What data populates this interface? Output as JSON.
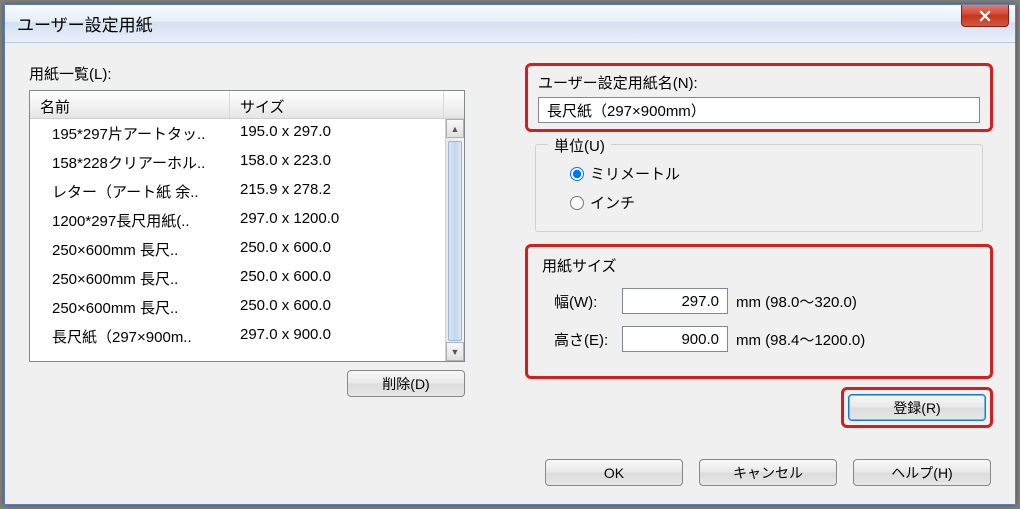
{
  "window_title": "ユーザー設定用紙",
  "list_label": "用紙一覧(L):",
  "columns": {
    "name": "名前",
    "size": "サイズ"
  },
  "col_widths": {
    "name": 200,
    "size": 214
  },
  "rows": [
    {
      "name": "195*297片アートタッ..",
      "size": "195.0 x 297.0"
    },
    {
      "name": "158*228クリアーホル..",
      "size": "158.0 x 223.0"
    },
    {
      "name": "レター（アート紙 余..",
      "size": "215.9 x 278.2"
    },
    {
      "name": "1200*297長尺用紙(..",
      "size": "297.0 x 1200.0"
    },
    {
      "name": "250×600mm 長尺..",
      "size": "250.0 x 600.0"
    },
    {
      "name": "250×600mm 長尺..",
      "size": "250.0 x 600.0"
    },
    {
      "name": "250×600mm 長尺..",
      "size": "250.0 x 600.0"
    },
    {
      "name": "長尺紙（297×900m..",
      "size": "297.0 x 900.0"
    }
  ],
  "delete_btn": "削除(D)",
  "name_label": "ユーザー設定用紙名(N):",
  "name_value": "長尺紙（297×900mm）",
  "unit_group": "単位(U)",
  "unit_mm": "ミリメートル",
  "unit_inch": "インチ",
  "unit_selected": "mm",
  "size_group": "用紙サイズ",
  "width_label": "幅(W):",
  "width_value": "297.0",
  "width_suffix": "mm (98.0～320.0)",
  "height_label": "高さ(E):",
  "height_value": "900.0",
  "height_suffix": "mm (98.4～1200.0)",
  "register_btn": "登録(R)",
  "ok_btn": "OK",
  "cancel_btn": "キャンセル",
  "help_btn": "ヘルプ(H)"
}
